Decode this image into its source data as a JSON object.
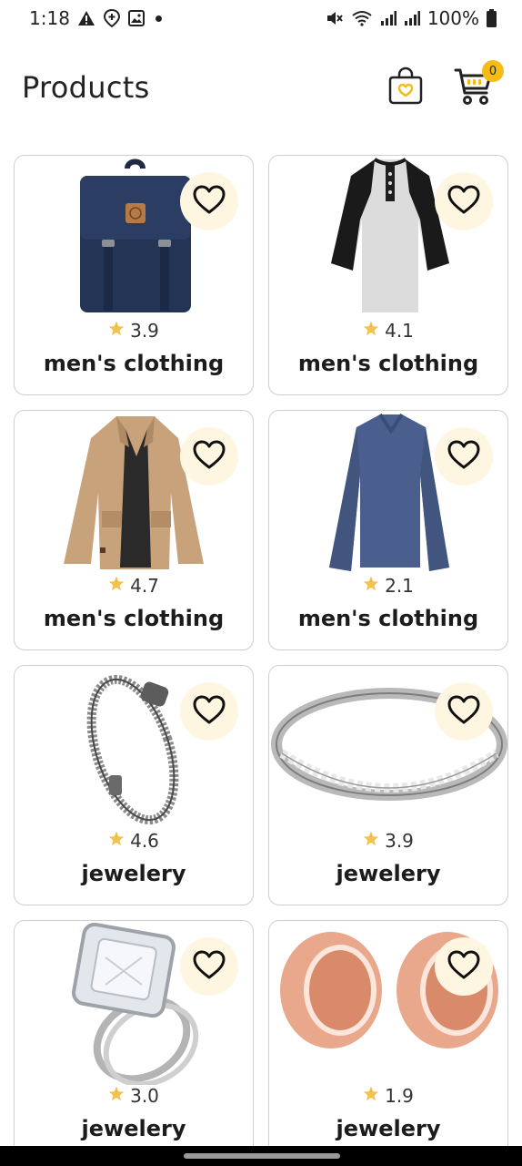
{
  "status_bar": {
    "time": "1:18",
    "battery": "100%",
    "icons": [
      "warning-icon",
      "location-plus-icon",
      "image-icon",
      "notification-dot-icon",
      "mute-icon",
      "wifi-icon",
      "signal-icon",
      "signal-icon",
      "battery-icon"
    ]
  },
  "header": {
    "title": "Products",
    "bag_icon": "shopping-bag-heart-icon",
    "cart_icon": "cart-icon",
    "cart_count": "0"
  },
  "colors": {
    "accent": "#f5bc16",
    "fav_bg": "#fff6e2",
    "star": "#f2c14e",
    "card_border": "#cfcfcf"
  },
  "products": [
    {
      "image": "backpack",
      "rating": "3.9",
      "category": "men's clothing"
    },
    {
      "image": "raglan-tshirt",
      "rating": "4.1",
      "category": "men's clothing"
    },
    {
      "image": "cotton-jacket",
      "rating": "4.7",
      "category": "men's clothing"
    },
    {
      "image": "long-sleeve-tshirt",
      "rating": "2.1",
      "category": "men's clothing"
    },
    {
      "image": "dragon-bracelet",
      "rating": "4.6",
      "category": "jewelery"
    },
    {
      "image": "silver-ring",
      "rating": "3.9",
      "category": "jewelery"
    },
    {
      "image": "princess-ring",
      "rating": "3.0",
      "category": "jewelery"
    },
    {
      "image": "rose-gold-plugs",
      "rating": "1.9",
      "category": "jewelery"
    }
  ]
}
